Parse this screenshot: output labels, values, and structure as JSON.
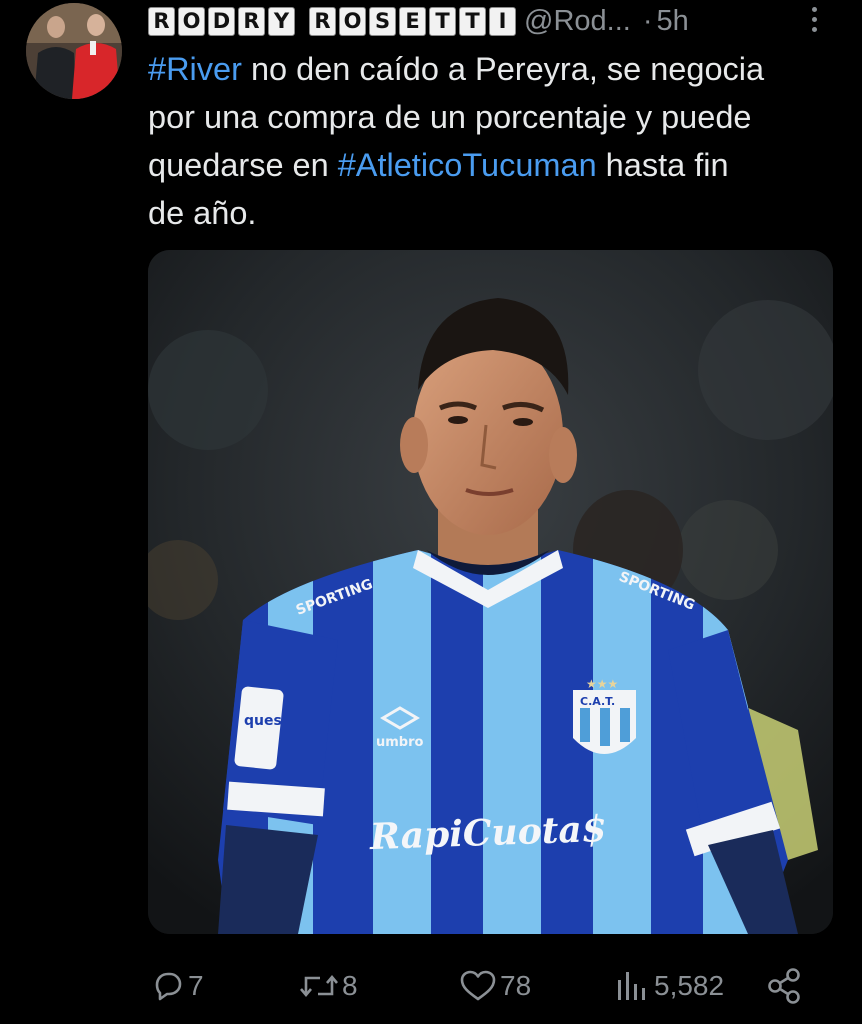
{
  "author": {
    "name_tiles": [
      [
        "R",
        "O",
        "D",
        "R",
        "Y"
      ],
      [
        "R",
        "O",
        "S",
        "E",
        "T",
        "T",
        "I"
      ]
    ],
    "handle": "@Rod...",
    "separator": "·",
    "time": "5h"
  },
  "tweet": {
    "line1": {
      "hashtag": "#River",
      "text": " no den caído a Pereyra, se negocia"
    },
    "line2": "por una compra de un porcentaje y puede",
    "line3": {
      "before": "quedarse en ",
      "hashtag": "#AtleticoTucuman",
      "after": " hasta fin"
    },
    "line4": "de año."
  },
  "media": {
    "jersey_brand": "SPORTING",
    "kit_maker": "umbro",
    "crest": "C.A.T.",
    "sponsor": "RapiCuota$",
    "sleeve_patch": "ques"
  },
  "actions": {
    "replies": "7",
    "reposts": "8",
    "likes": "78",
    "views": "5,582"
  },
  "colors": {
    "background": "#000000",
    "text": "#e7e9ea",
    "muted": "#8b9095",
    "hashtag": "#4a9cf0",
    "jersey_light": "#7cc2ef",
    "jersey_dark": "#1d3fae"
  },
  "icons": [
    "reply-icon",
    "repost-icon",
    "like-icon",
    "views-icon",
    "share-icon",
    "more-icon"
  ]
}
